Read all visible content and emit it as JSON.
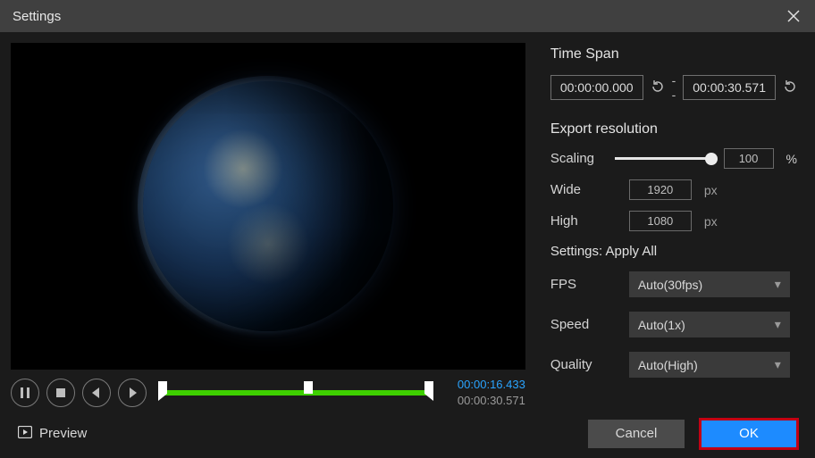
{
  "window": {
    "title": "Settings"
  },
  "timespan": {
    "header": "Time Span",
    "start": "00:00:00.000",
    "end": "00:00:30.571",
    "separator": "--"
  },
  "export": {
    "header": "Export resolution",
    "scaling_label": "Scaling",
    "scaling_value": "100",
    "scaling_unit": "%",
    "wide_label": "Wide",
    "wide_value": "1920",
    "high_label": "High",
    "high_value": "1080",
    "px_unit": "px"
  },
  "settings_apply": {
    "header": "Settings: Apply All",
    "fps_label": "FPS",
    "fps_value": "Auto(30fps)",
    "speed_label": "Speed",
    "speed_value": "Auto(1x)",
    "quality_label": "Quality",
    "quality_value": "Auto(High)"
  },
  "player": {
    "current": "00:00:16.433",
    "total": "00:00:30.571",
    "playhead_pct": 53
  },
  "footer": {
    "preview": "Preview",
    "cancel": "Cancel",
    "ok": "OK"
  }
}
